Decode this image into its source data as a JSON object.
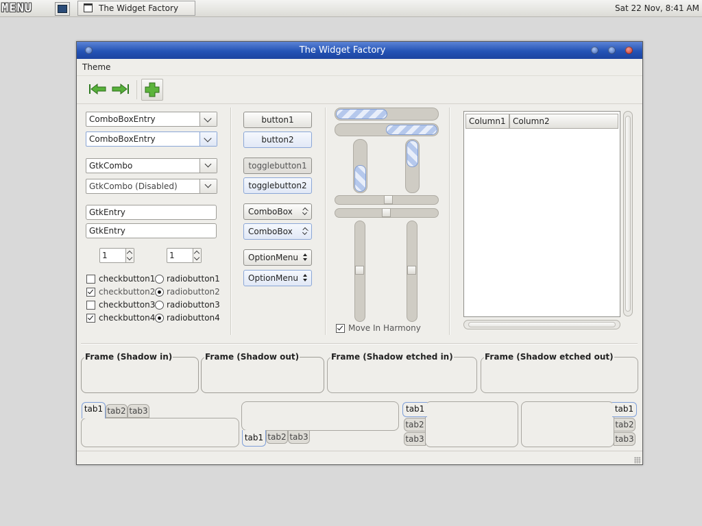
{
  "taskbar": {
    "menu_label": "MENU",
    "task_title": "The Widget Factory",
    "clock": "Sat 22 Nov,  8:41 AM"
  },
  "window": {
    "title": "The Widget Factory",
    "menubar": {
      "theme": "Theme"
    },
    "toolbar": {
      "icons": [
        "go-first-icon",
        "go-last-icon",
        "add-icon"
      ]
    }
  },
  "col1": {
    "combo_entry_1": "ComboBoxEntry",
    "combo_entry_2": "ComboBoxEntry",
    "gtk_combo": "GtkCombo",
    "gtk_combo_disabled": "GtkCombo (Disabled)",
    "entry_1": "GtkEntry",
    "entry_2": "GtkEntry",
    "spin_1": "1",
    "spin_2": "1",
    "checks": [
      {
        "label": "checkbutton1",
        "checked": false
      },
      {
        "label": "checkbutton2",
        "checked": true
      },
      {
        "label": "checkbutton3",
        "checked": false
      },
      {
        "label": "checkbutton4",
        "checked": true
      }
    ],
    "radios": [
      {
        "label": "radiobutton1",
        "selected": false
      },
      {
        "label": "radiobutton2",
        "selected": true
      },
      {
        "label": "radiobutton3",
        "selected": false
      },
      {
        "label": "radiobutton4",
        "selected": true
      }
    ]
  },
  "col2": {
    "button1": "button1",
    "button2": "button2",
    "toggle1": "togglebutton1",
    "toggle2": "togglebutton2",
    "combobox1": "ComboBox",
    "combobox2": "ComboBox",
    "option1": "OptionMenu",
    "option2": "OptionMenu"
  },
  "col3": {
    "move_in_harmony": "Move In Harmony",
    "move_in_harmony_checked": true
  },
  "tree": {
    "column1": "Column1",
    "column2": "Column2"
  },
  "frames": [
    "Frame (Shadow in)",
    "Frame (Shadow out)",
    "Frame (Shadow etched in)",
    "Frame (Shadow etched out)"
  ],
  "notebooks": {
    "tabs": [
      "tab1",
      "tab2",
      "tab3"
    ]
  }
}
